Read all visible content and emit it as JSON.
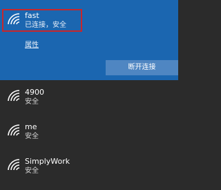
{
  "active_network": {
    "name": "fast",
    "status": "已连接，安全",
    "properties_link": "属性",
    "disconnect_button": "断开连接",
    "icon": "wifi-secured-icon"
  },
  "networks": [
    {
      "name": "4900",
      "status": "安全",
      "icon": "wifi-secured-icon"
    },
    {
      "name": "me",
      "status": "安全",
      "icon": "wifi-secured-icon"
    },
    {
      "name": "SimplyWork",
      "status": "安全",
      "icon": "wifi-secured-icon"
    }
  ],
  "colors": {
    "active_background": "#1b66b0",
    "list_background": "#2b2b2b",
    "highlight_border": "#c8262b",
    "button_background": "#4f86c2"
  }
}
